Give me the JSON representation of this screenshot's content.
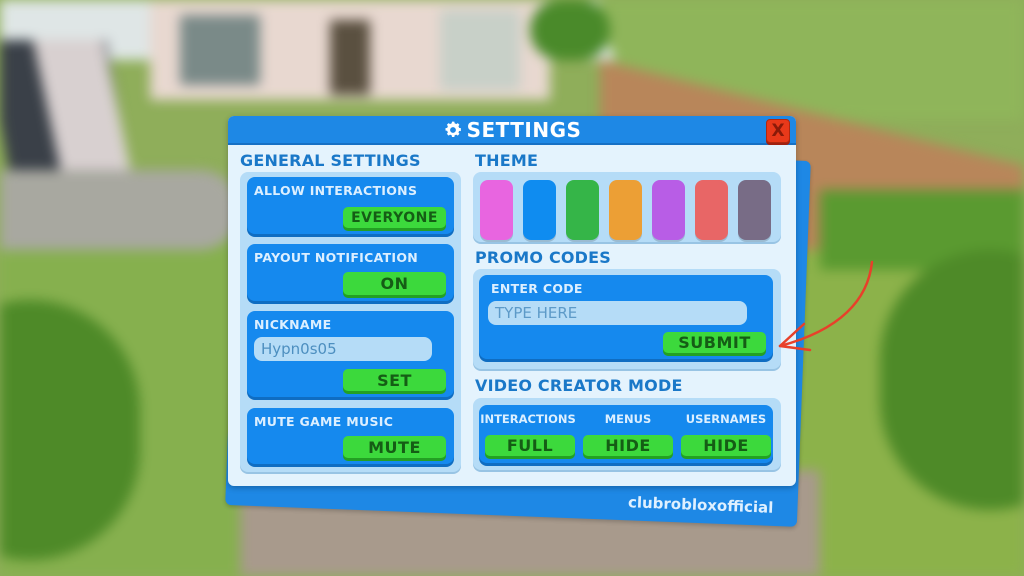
{
  "window": {
    "title": "SETTINGS",
    "title_icon": "gear-icon",
    "close_label": "X"
  },
  "general": {
    "title": "GENERAL SETTINGS",
    "allow_interactions": {
      "label": "ALLOW INTERACTIONS",
      "value": "EVERYONE"
    },
    "payout_notification": {
      "label": "PAYOUT NOTIFICATION",
      "value": "ON"
    },
    "nickname": {
      "label": "NICKNAME",
      "input_value": "Hypn0s05",
      "button": "SET"
    },
    "mute_music": {
      "label": "MUTE GAME MUSIC",
      "button": "MUTE"
    }
  },
  "theme": {
    "title": "THEME",
    "swatches": [
      {
        "name": "pink",
        "color": "#e865e0"
      },
      {
        "name": "blue",
        "color": "#0f8cf0"
      },
      {
        "name": "green",
        "color": "#35b548"
      },
      {
        "name": "orange",
        "color": "#ec9f35"
      },
      {
        "name": "purple",
        "color": "#b85de6"
      },
      {
        "name": "red",
        "color": "#e86666"
      },
      {
        "name": "slate",
        "color": "#786c86"
      }
    ]
  },
  "promo": {
    "title": "PROMO CODES",
    "label": "ENTER CODE",
    "placeholder": "TYPE HERE",
    "button": "SUBMIT"
  },
  "video_creator": {
    "title": "VIDEO CREATOR MODE",
    "options": [
      {
        "label": "INTERACTIONS",
        "value": "FULL"
      },
      {
        "label": "MENUS",
        "value": "HIDE"
      },
      {
        "label": "USERNAMES",
        "value": "HIDE"
      }
    ]
  },
  "watermark": "clubrobloxofficial",
  "colors": {
    "primary_blue": "#1589ee",
    "panel_bg": "#e4f3fd",
    "button_green": "#3cd93c",
    "close_red": "#e8391a",
    "annotation_arrow": "#e8402a"
  }
}
